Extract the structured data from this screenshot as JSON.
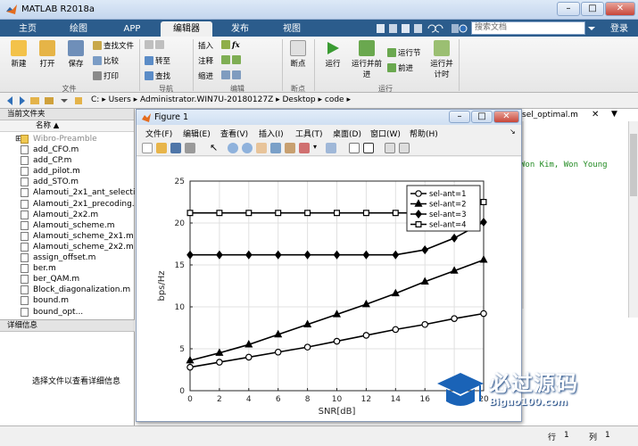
{
  "window": {
    "title": "MATLAB R2018a",
    "min": "–",
    "max": "□",
    "close": "✕"
  },
  "tabs": [
    {
      "label": "主页"
    },
    {
      "label": "绘图"
    },
    {
      "label": "APP"
    },
    {
      "label": "编辑器"
    },
    {
      "label": "发布"
    },
    {
      "label": "视图"
    }
  ],
  "search": {
    "placeholder": "搜索文档",
    "login": "登录"
  },
  "ribbon": {
    "file": {
      "new": "新建",
      "open": "打开",
      "save": "保存",
      "find_files": "查找文件",
      "compare": "比较",
      "print": "打印",
      "group": "文件"
    },
    "nav": {
      "goto": "转至",
      "find": "查找",
      "group": "导航"
    },
    "edit": {
      "insert": "插入",
      "comment": "注释",
      "indent": "缩进",
      "fx": "fx",
      "group": "编辑"
    },
    "breakpoints": {
      "label": "断点",
      "group": "断点"
    },
    "run": {
      "run": "运行",
      "run_advance": "运行并前进",
      "run_section": "运行节",
      "advance": "前进",
      "run_time": "运行并计时",
      "group": "运行"
    }
  },
  "address": {
    "path": [
      "C:",
      "Users",
      "Administrator.WIN7U-20180127Z",
      "Desktop",
      "code"
    ]
  },
  "left": {
    "panel_title": "当前文件夹",
    "col_name": "名称 ▲",
    "files": [
      "Wibro-Preamble",
      "add_CFO.m",
      "add_CP.m",
      "add_pilot.m",
      "add_STO.m",
      "Alamouti_2x1_ant_selecti...",
      "Alamouti_2x1_precoding...",
      "Alamouti_2x2.m",
      "Alamouti_scheme.m",
      "Alamouti_scheme_2x1.m",
      "Alamouti_scheme_2x2.m",
      "assign_offset.m",
      "ber.m",
      "ber_QAM.m",
      "Block_diagonalization.m",
      "bound.m",
      "bound_opt..."
    ],
    "details_title": "详细信息",
    "details_msg": "选择文件以查看详细信息"
  },
  "editor": {
    "tab": "sel_optimal.m",
    "code_line": "Won Kim, Won Young"
  },
  "figure": {
    "title": "Figure 1",
    "menus": [
      "文件(F)",
      "编辑(E)",
      "查看(V)",
      "插入(I)",
      "工具(T)",
      "桌面(D)",
      "窗口(W)",
      "帮助(H)"
    ]
  },
  "status": {
    "row_label": "行",
    "row": "1",
    "col_label": "列",
    "col": "1"
  },
  "watermark": {
    "text": "必过源码",
    "url": "Biguo100.com"
  },
  "chart_data": {
    "type": "line",
    "xlabel": "SNR[dB]",
    "ylabel": "bps/Hz",
    "xlim": [
      0,
      20
    ],
    "ylim": [
      0,
      25
    ],
    "xticks": [
      0,
      2,
      4,
      6,
      8,
      10,
      12,
      14,
      16,
      18,
      20
    ],
    "yticks": [
      0,
      5,
      10,
      15,
      20,
      25
    ],
    "grid": true,
    "legend_position": "top-right",
    "x": [
      0,
      2,
      4,
      6,
      8,
      10,
      12,
      14,
      16,
      18,
      20
    ],
    "series": [
      {
        "name": "sel-ant=1",
        "marker": "circle",
        "values": [
          2.8,
          3.4,
          4.0,
          4.6,
          5.2,
          5.9,
          6.6,
          7.3,
          7.9,
          8.6,
          9.2
        ]
      },
      {
        "name": "sel-ant=2",
        "marker": "triangle",
        "values": [
          3.6,
          4.5,
          5.5,
          6.7,
          7.9,
          9.1,
          10.3,
          11.6,
          13.0,
          14.3,
          15.6
        ]
      },
      {
        "name": "sel-ant=3",
        "marker": "diamond",
        "values": [
          16.2,
          16.2,
          16.2,
          16.2,
          16.2,
          16.2,
          16.2,
          16.2,
          16.8,
          18.2,
          20.1
        ]
      },
      {
        "name": "sel-ant=4",
        "marker": "square",
        "values": [
          21.2,
          21.2,
          21.2,
          21.2,
          21.2,
          21.2,
          21.2,
          21.2,
          21.2,
          21.4,
          22.5
        ]
      }
    ]
  }
}
